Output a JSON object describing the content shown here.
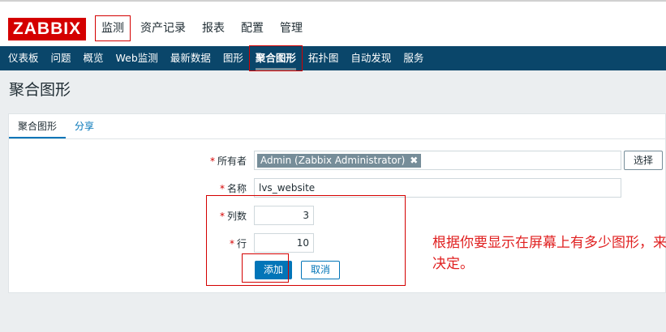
{
  "logo": {
    "text": "ZABBIX",
    "color": "#d40000"
  },
  "main_menu": [
    {
      "label": "监测",
      "active": true
    },
    {
      "label": "资产记录"
    },
    {
      "label": "报表"
    },
    {
      "label": "配置"
    },
    {
      "label": "管理"
    }
  ],
  "sub_menu": [
    {
      "label": "仪表板"
    },
    {
      "label": "问题"
    },
    {
      "label": "概览"
    },
    {
      "label": "Web监测"
    },
    {
      "label": "最新数据"
    },
    {
      "label": "图形"
    },
    {
      "label": "聚合图形",
      "active": true
    },
    {
      "label": "拓扑图"
    },
    {
      "label": "自动发现"
    },
    {
      "label": "服务"
    }
  ],
  "page": {
    "title": "聚合图形"
  },
  "tabs": [
    {
      "label": "聚合图形",
      "active": true
    },
    {
      "label": "分享"
    }
  ],
  "form": {
    "required_mark": "*",
    "owner": {
      "label": "所有者",
      "value": "Admin (Zabbix Administrator)",
      "remove_glyph": "✖",
      "select_label": "选择"
    },
    "name": {
      "label": "名称",
      "value": "lvs_website"
    },
    "columns": {
      "label": "列数",
      "value": "3"
    },
    "rows": {
      "label": "行",
      "value": "10"
    },
    "add_label": "添加",
    "cancel_label": "取消"
  },
  "annotation": {
    "text": "根据你要显示在屏幕上有多少图形，来决定。",
    "color": "#e02020"
  },
  "colors": {
    "nav_bg": "#0a466a",
    "accent": "#0275b8",
    "highlight": "#d40000"
  }
}
